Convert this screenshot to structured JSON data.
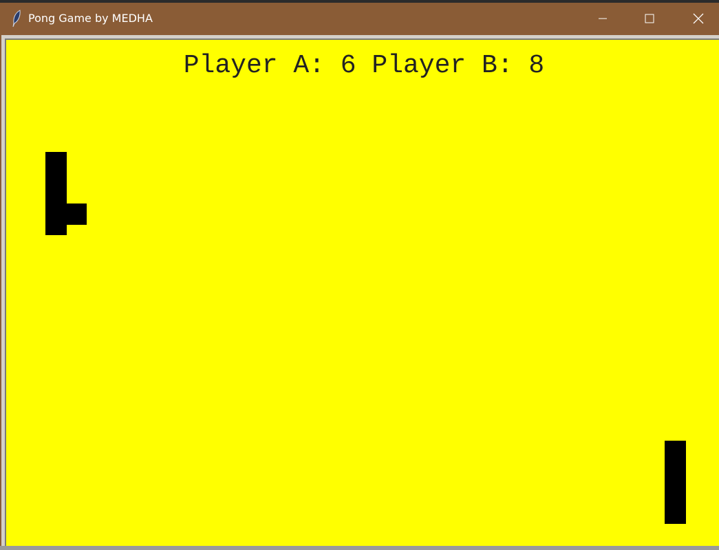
{
  "window": {
    "title": "Pong Game by MEDHA",
    "titlebar_color": "#8a5c36"
  },
  "controls": {
    "minimize_icon": "minimize-icon",
    "maximize_icon": "maximize-icon",
    "close_icon": "close-icon"
  },
  "game": {
    "background_color": "#ffff00",
    "score_text": "Player A: 6 Player B: 8",
    "player_a_score": 6,
    "player_b_score": 8,
    "paddle_color": "#000000"
  }
}
